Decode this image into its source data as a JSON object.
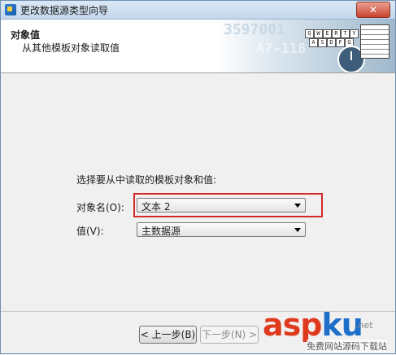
{
  "window": {
    "title": "更改数据源类型向导",
    "close_glyph": "✕"
  },
  "header": {
    "title": "对象值",
    "subtitle": "从其他模板对象读取值",
    "art_numbers": [
      "3597001",
      "A7-118"
    ],
    "art_keys": [
      "Q",
      "W",
      "E",
      "R",
      "T",
      "Y",
      "A",
      "S",
      "D",
      "F",
      "G"
    ]
  },
  "form": {
    "prompt": "选择要从中读取的模板对象和值:",
    "object_name_label": "对象名(O):",
    "object_name_value": "文本 2",
    "value_label": "值(V):",
    "value_value": "主数据源"
  },
  "buttons": {
    "prev": "< 上一步(B)",
    "next": "下一步(N) >"
  },
  "watermark": {
    "logo_a": "asp",
    "logo_b": "ku",
    "suffix": ".net",
    "caption": "免费网站源码下载站"
  },
  "colors": {
    "highlight": "#d32929",
    "titlebar": "#c3d7ec"
  }
}
